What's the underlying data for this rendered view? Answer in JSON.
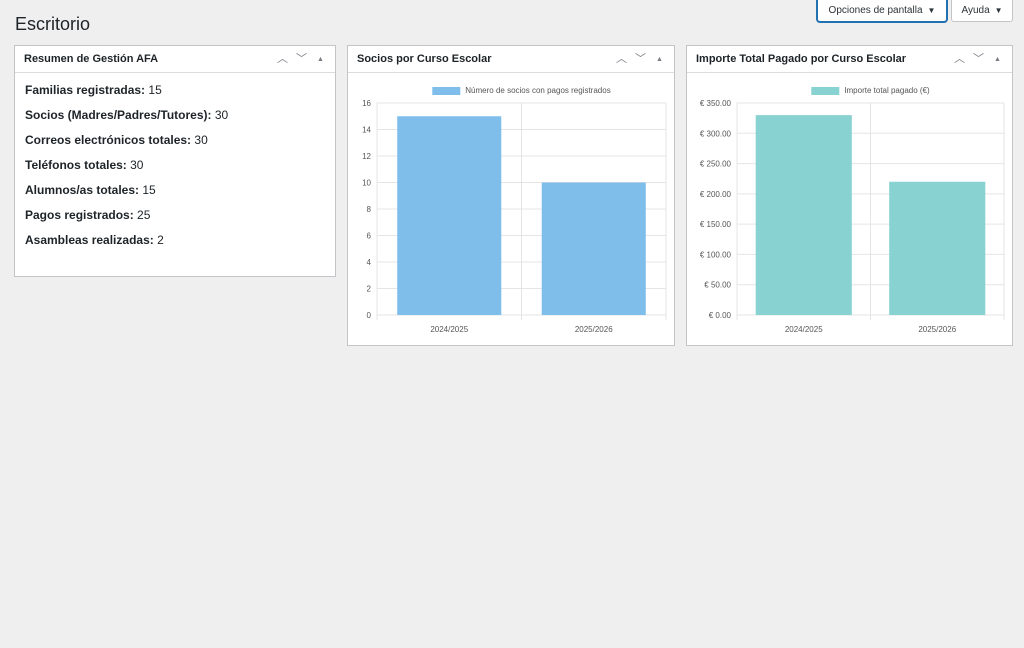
{
  "page": {
    "title": "Escritorio"
  },
  "header": {
    "screen_options_label": "Opciones de pantalla",
    "help_label": "Ayuda",
    "caret": "▼"
  },
  "widgets": {
    "resumen": {
      "title": "Resumen de Gestión AFA",
      "items": [
        {
          "label": "Familias registradas:",
          "value": "15"
        },
        {
          "label": "Socios (Madres/Padres/Tutores):",
          "value": "30"
        },
        {
          "label": "Correos electrónicos totales:",
          "value": "30"
        },
        {
          "label": "Teléfonos totales:",
          "value": "30"
        },
        {
          "label": "Alumnos/as totales:",
          "value": "15"
        },
        {
          "label": "Pagos registrados:",
          "value": "25"
        },
        {
          "label": "Asambleas realizadas:",
          "value": "2"
        }
      ]
    },
    "socios": {
      "title": "Socios por Curso Escolar"
    },
    "importe": {
      "title": "Importe Total Pagado por Curso Escolar"
    }
  },
  "icons": {
    "up": "chevron-up-icon",
    "down": "chevron-down-icon",
    "toggle": "triangle-up-icon"
  },
  "chart_data": [
    {
      "type": "bar",
      "categories": [
        "2024/2025",
        "2025/2026"
      ],
      "series": [
        {
          "name": "Número de socios con pagos registrados",
          "values": [
            15,
            10
          ]
        }
      ],
      "ylim": [
        0,
        16
      ],
      "yticks": [
        0,
        2,
        4,
        6,
        8,
        10,
        12,
        14,
        16
      ],
      "ytick_labels": [
        "0",
        "2",
        "4",
        "6",
        "8",
        "10",
        "12",
        "14",
        "16"
      ],
      "color": "#7fbdeb",
      "grid": true,
      "legend": "top-center"
    },
    {
      "type": "bar",
      "categories": [
        "2024/2025",
        "2025/2026"
      ],
      "series": [
        {
          "name": "Importe total pagado (€)",
          "values": [
            330,
            220
          ]
        }
      ],
      "ylim": [
        0,
        350
      ],
      "yticks": [
        0,
        50,
        100,
        150,
        200,
        250,
        300,
        350
      ],
      "ytick_labels": [
        "€ 0.00",
        "€ 50.00",
        "€ 100.00",
        "€ 150.00",
        "€ 200.00",
        "€ 250.00",
        "€ 300.00",
        "€ 350.00"
      ],
      "color": "#88d2d1",
      "grid": true,
      "legend": "top-center"
    }
  ]
}
